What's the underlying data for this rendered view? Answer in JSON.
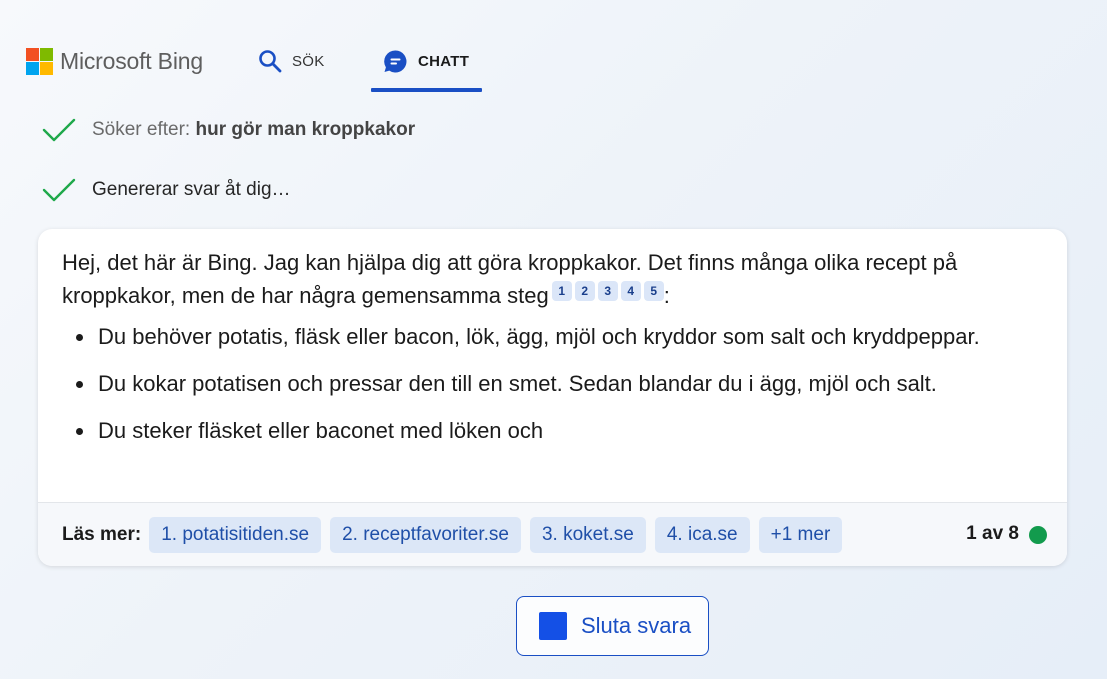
{
  "header": {
    "logo_text": "Microsoft Bing",
    "logo_colors": [
      "#f25022",
      "#7fba00",
      "#00a4ef",
      "#ffb900"
    ],
    "tabs": [
      {
        "label": "SÖK",
        "icon": "search-icon",
        "active": false
      },
      {
        "label": "CHATT",
        "icon": "chat-icon",
        "active": true
      }
    ]
  },
  "status": {
    "searching_prefix": "Söker efter: ",
    "searching_query": "hur gör man kroppkakor",
    "generating": "Genererar svar åt dig…"
  },
  "answer": {
    "intro": "Hej, det här är Bing. Jag kan hjälpa dig att göra kroppkakor. Det finns många olika recept på kroppkakor, men de har några gemensamma steg",
    "intro_end": ":",
    "citations": [
      "1",
      "2",
      "3",
      "4",
      "5"
    ],
    "bullets": [
      "Du behöver potatis, fläsk eller bacon, lök, ägg, mjöl och kryddor som salt och kryddpeppar.",
      "Du kokar potatisen och pressar den till en smet. Sedan blandar du i ägg, mjöl och salt.",
      "Du steker fläsket eller baconet med löken och"
    ]
  },
  "footer": {
    "read_more_label": "Läs mer:",
    "sources": [
      "1. potatisitiden.se",
      "2. receptfavoriter.se",
      "3. koket.se",
      "4. ica.se",
      "+1 mer"
    ],
    "counter": "1 av 8",
    "status_color": "#129b4d"
  },
  "stop_button": {
    "label": "Sluta svara"
  },
  "colors": {
    "accent": "#1a4fc4",
    "check": "#1ea84a"
  }
}
